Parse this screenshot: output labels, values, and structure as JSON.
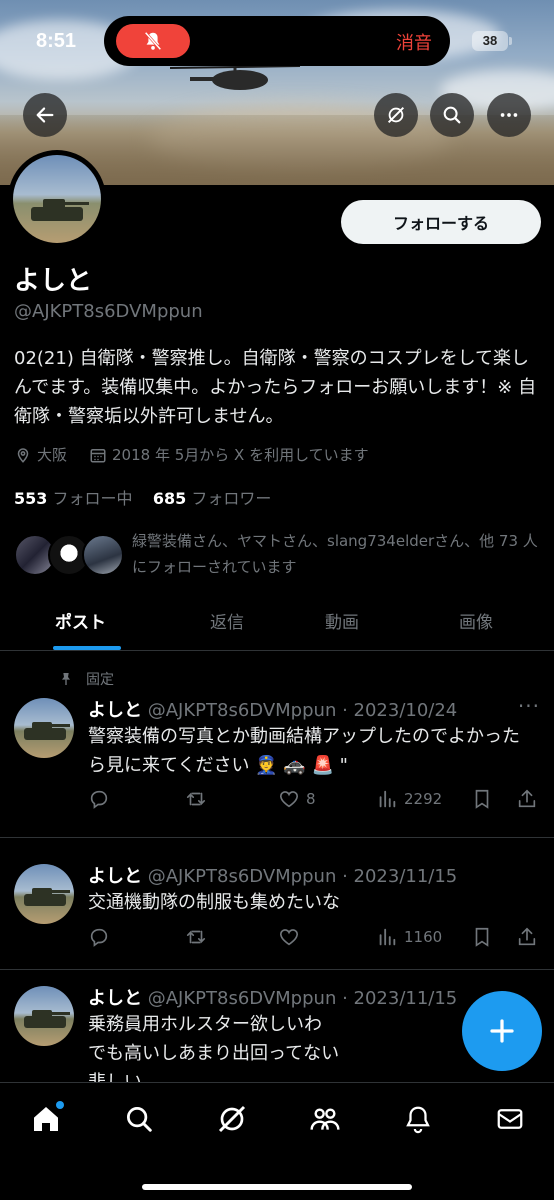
{
  "status_bar": {
    "time": "8:51",
    "mute_label": "消音",
    "battery": "38"
  },
  "profile": {
    "follow_button": "フォローする",
    "name": "よしと",
    "handle": "@AJKPT8s6DVMppun",
    "bio": "02(21) 自衛隊・警察推し。自衛隊・警察のコスプレをして楽しんでます。装備収集中。よかったらフォローお願いします！※ 自衛隊・警察垢以外許可しません。",
    "location": "大阪",
    "joined": "2018 年 5月から X を利用しています",
    "following_count": "553",
    "following_label": "フォロー中",
    "followers_count": "685",
    "followers_label": "フォロワー",
    "followed_by": "緑警装備さん、ヤマトさん、slang734elderさん、他 73 人にフォローされています"
  },
  "tabs": [
    {
      "label": "ポスト",
      "active": true
    },
    {
      "label": "返信",
      "active": false
    },
    {
      "label": "動画",
      "active": false
    },
    {
      "label": "画像",
      "active": false
    }
  ],
  "posts": [
    {
      "pinned_label": "固定",
      "name": "よしと",
      "meta": "@AJKPT8s6DVMppun · 2023/10/24",
      "text": "警察装備の写真とか動画結構アップしたのでよかったら見に来てください 👮 🚓 🚨 \"",
      "likes": "8",
      "views": "2292"
    },
    {
      "name": "よしと",
      "meta": "@AJKPT8s6DVMppun · 2023/11/15",
      "text": "交通機動隊の制服も集めたいな",
      "likes": "",
      "views": "1160"
    },
    {
      "name": "よしと",
      "meta": "@AJKPT8s6DVMppun · 2023/11/15",
      "text": "乗務員用ホルスター欲しいわ\nでも高いしあまり出回ってない\n悲しい"
    }
  ],
  "icons": {
    "back": "arrow-left-icon",
    "grok": "grok-icon",
    "search": "search-icon",
    "more": "more-icon",
    "reply": "reply-icon",
    "repost": "repost-icon",
    "like": "heart-icon",
    "views": "views-icon",
    "bookmark": "bookmark-icon",
    "share": "share-icon",
    "compose": "plus-icon",
    "home": "home-icon",
    "communities": "people-icon",
    "notifications": "bell-icon",
    "messages": "mail-icon"
  },
  "colors": {
    "accent": "#1d9bf0",
    "mute_red": "#f0433a",
    "muted_text": "#71767b"
  }
}
